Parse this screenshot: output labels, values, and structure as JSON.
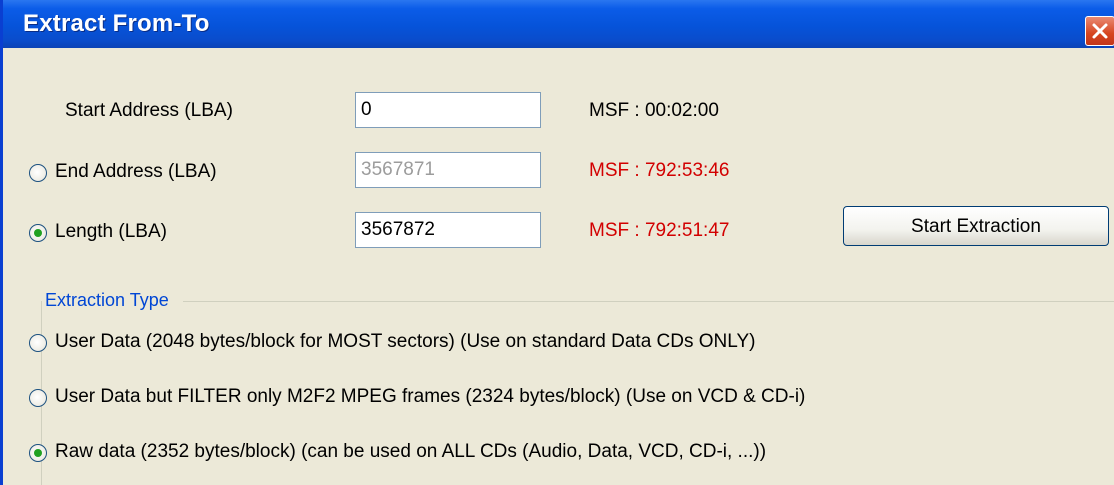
{
  "window": {
    "title": "Extract From-To"
  },
  "start": {
    "label": "Start Address (LBA)",
    "value": "0",
    "msf": "MSF : 00:02:00"
  },
  "end": {
    "label": "End Address (LBA)",
    "value": "3567871",
    "msf": "MSF : 792:53:46",
    "selected": false
  },
  "length": {
    "label": "Length (LBA)",
    "value": "3567872",
    "msf": "MSF : 792:51:47",
    "selected": true
  },
  "actions": {
    "start_extraction": "Start Extraction"
  },
  "extraction_type": {
    "group_label": "Extraction Type",
    "options": [
      {
        "label": "User Data (2048 bytes/block for MOST sectors) (Use on standard Data CDs ONLY)",
        "selected": false
      },
      {
        "label": "User Data but FILTER only M2F2 MPEG frames (2324 bytes/block) (Use on VCD & CD-i)",
        "selected": false
      },
      {
        "label": "Raw data (2352 bytes/block) (can be used on ALL CDs (Audio, Data, VCD, CD-i, ...))",
        "selected": true
      }
    ]
  },
  "colors": {
    "title_blue": "#0653d9",
    "msf_red": "#d20000",
    "group_label_blue": "#0046d5",
    "radio_checked": "#21a121"
  }
}
